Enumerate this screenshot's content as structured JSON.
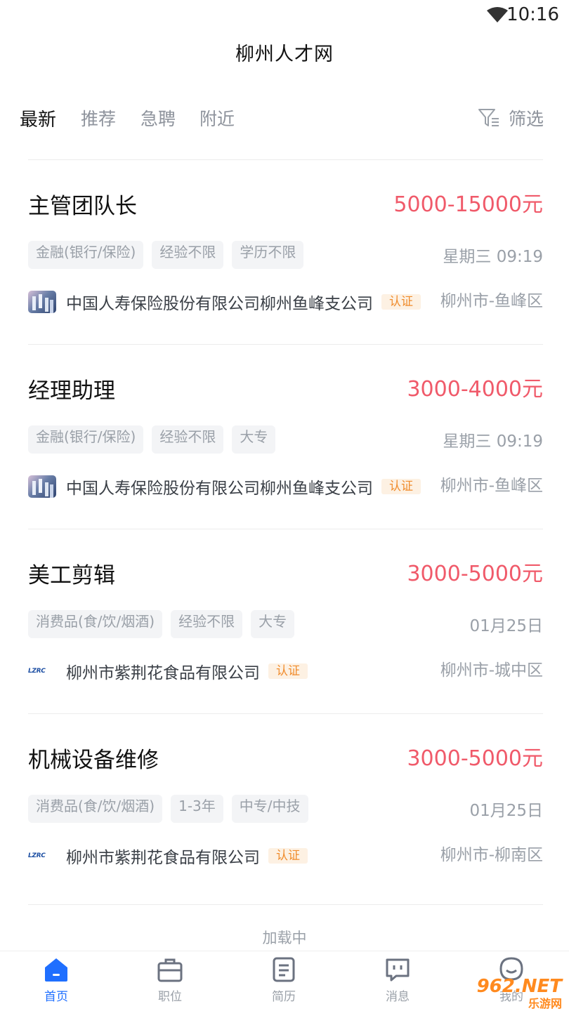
{
  "status_bar": {
    "time": "10:16"
  },
  "header": {
    "title": "柳州人才网"
  },
  "tabs": [
    {
      "label": "最新",
      "active": true
    },
    {
      "label": "推荐",
      "active": false
    },
    {
      "label": "急聘",
      "active": false
    },
    {
      "label": "附近",
      "active": false
    }
  ],
  "filter": {
    "label": "筛选",
    "icon": "filter-icon"
  },
  "jobs": [
    {
      "title": "主管团队长",
      "salary": "5000-15000元",
      "tags": [
        "金融(银行/保险)",
        "经验不限",
        "学历不限"
      ],
      "date": "星期三 09:19",
      "company": "中国人寿保险股份有限公司柳州鱼峰支公司",
      "cert": "认证",
      "location": "柳州市-鱼峰区"
    },
    {
      "title": "经理助理",
      "salary": "3000-4000元",
      "tags": [
        "金融(银行/保险)",
        "经验不限",
        "大专"
      ],
      "date": "星期三 09:19",
      "company": "中国人寿保险股份有限公司柳州鱼峰支公司",
      "cert": "认证",
      "location": "柳州市-鱼峰区"
    },
    {
      "title": "美工剪辑",
      "salary": "3000-5000元",
      "tags": [
        "消费品(食/饮/烟酒)",
        "经验不限",
        "大专"
      ],
      "date": "01月25日",
      "company": "柳州市紫荆花食品有限公司",
      "logo_text": "LZRC",
      "cert": "认证",
      "location": "柳州市-城中区"
    },
    {
      "title": "机械设备维修",
      "salary": "3000-5000元",
      "tags": [
        "消费品(食/饮/烟酒)",
        "1-3年",
        "中专/中技"
      ],
      "date": "01月25日",
      "company": "柳州市紫荆花食品有限公司",
      "logo_text": "LZRC",
      "cert": "认证",
      "location": "柳州市-柳南区"
    }
  ],
  "loading_text": "加载中",
  "bottom_nav": [
    {
      "label": "首页",
      "icon": "home-icon",
      "active": true
    },
    {
      "label": "职位",
      "icon": "briefcase-icon",
      "active": false
    },
    {
      "label": "简历",
      "icon": "resume-icon",
      "active": false
    },
    {
      "label": "消息",
      "icon": "message-icon",
      "active": false
    },
    {
      "label": "我的",
      "icon": "profile-icon",
      "active": false
    }
  ],
  "watermark": {
    "main": "962.NET",
    "sub": "乐游网"
  },
  "colors": {
    "accent": "#1f6fff",
    "salary": "#f05a6a",
    "cert": "#f08c2d"
  }
}
